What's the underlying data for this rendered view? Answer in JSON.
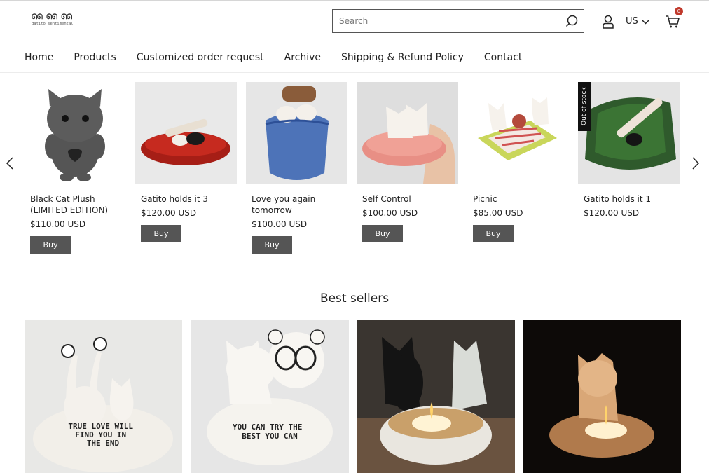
{
  "header": {
    "logo_text": "gatito sentimental",
    "logo_glyphs": "ᘏᘏ ᘏᘏ ᘏᘏ",
    "search": {
      "placeholder": "Search"
    },
    "currency": "US",
    "cart_count": "0"
  },
  "nav": {
    "items": [
      "Home",
      "Products",
      "Customized order request",
      "Archive",
      "Shipping & Refund Policy",
      "Contact"
    ]
  },
  "products": [
    {
      "name": "Black Cat Plush (LIMITED EDITION)",
      "price": "$110.00 USD",
      "buy": "Buy"
    },
    {
      "name": "Gatito holds it 3",
      "price": "$120.00 USD",
      "buy": "Buy"
    },
    {
      "name": "Love you again tomorrow",
      "price": "$100.00 USD",
      "buy": "Buy"
    },
    {
      "name": "Self Control",
      "price": "$100.00 USD",
      "buy": "Buy"
    },
    {
      "name": "Picnic",
      "price": "$85.00 USD",
      "buy": "Buy"
    },
    {
      "name": "Gatito holds it 1",
      "price": "$120.00 USD",
      "badge": "Out of stock"
    }
  ],
  "best_sellers": {
    "title": "Best sellers",
    "items": [
      {
        "caption": "TRUE LOVE WILL FIND YOU IN THE END"
      },
      {
        "caption": "YOU CAN TRY THE BEST YOU CAN"
      },
      {
        "caption": ""
      },
      {
        "caption": ""
      }
    ]
  },
  "colors": {
    "button": "#555555",
    "badge": "#c0392b",
    "text": "#222222"
  }
}
